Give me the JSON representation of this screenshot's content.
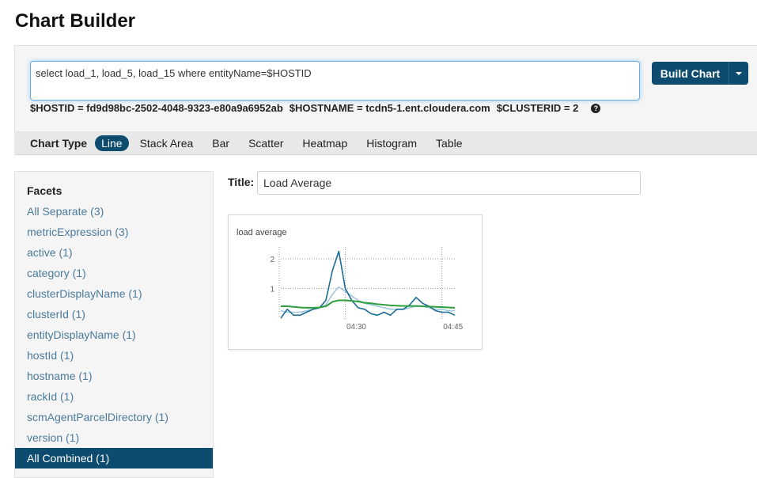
{
  "page": {
    "title": "Chart Builder"
  },
  "query": {
    "text": "select load_1, load_5, load_15 where entityName=$HOSTID",
    "build_label": "Build Chart"
  },
  "variables": {
    "hostid": "$HOSTID = fd9d98bc-2502-4048-9323-e80a9a6952ab",
    "hostname": "$HOSTNAME = tcdn5-1.ent.cloudera.com",
    "clusterid": "$CLUSTERID = 2",
    "help_icon": "question-circle-icon"
  },
  "chart_type": {
    "label": "Chart Type",
    "options": [
      "Line",
      "Stack Area",
      "Bar",
      "Scatter",
      "Heatmap",
      "Histogram",
      "Table"
    ],
    "selected": "Line"
  },
  "facets": {
    "title": "Facets",
    "items": [
      "All Separate (3)",
      "metricExpression (3)",
      "active (1)",
      "category (1)",
      "clusterDisplayName (1)",
      "clusterId (1)",
      "entityDisplayName (1)",
      "hostId (1)",
      "hostname (1)",
      "rackId (1)",
      "scmAgentParcelDirectory (1)",
      "version (1)",
      "All Combined (1)"
    ],
    "selected": "All Combined (1)"
  },
  "title_field": {
    "label": "Title:",
    "value": "Load Average"
  },
  "colors": {
    "accent": "#0d4c6e",
    "link": "#4a7a9c"
  },
  "chart_data": {
    "type": "line",
    "title": "load average",
    "x": [
      "04:20",
      "04:21",
      "04:22",
      "04:23",
      "04:24",
      "04:25",
      "04:26",
      "04:27",
      "04:28",
      "04:29",
      "04:30",
      "04:31",
      "04:32",
      "04:33",
      "04:34",
      "04:35",
      "04:36",
      "04:37",
      "04:38",
      "04:39",
      "04:40",
      "04:41",
      "04:42",
      "04:43",
      "04:44",
      "04:45",
      "04:46",
      "04:47"
    ],
    "x_ticks": [
      "04:30",
      "04:45"
    ],
    "y_ticks": [
      "1",
      "2"
    ],
    "ylim": [
      0,
      2.4
    ],
    "series": [
      {
        "color": "#1a6b96",
        "values": [
          0.0,
          0.3,
          0.1,
          0.1,
          0.2,
          0.3,
          0.35,
          0.6,
          1.6,
          2.25,
          1.0,
          0.6,
          0.35,
          0.3,
          0.15,
          0.1,
          0.2,
          0.1,
          0.3,
          0.3,
          0.45,
          0.7,
          0.5,
          0.4,
          0.25,
          0.2,
          0.2,
          0.1
        ]
      },
      {
        "color": "#9fc7da",
        "values": [
          0.25,
          0.2,
          0.2,
          0.2,
          0.25,
          0.3,
          0.35,
          0.45,
          0.8,
          1.05,
          0.9,
          0.75,
          0.6,
          0.5,
          0.45,
          0.4,
          0.35,
          0.3,
          0.3,
          0.3,
          0.35,
          0.4,
          0.4,
          0.35,
          0.3,
          0.3,
          0.25,
          0.25
        ]
      },
      {
        "color": "#2e9e3e",
        "values": [
          0.4,
          0.4,
          0.38,
          0.36,
          0.35,
          0.35,
          0.36,
          0.4,
          0.55,
          0.6,
          0.6,
          0.58,
          0.56,
          0.52,
          0.5,
          0.47,
          0.45,
          0.43,
          0.42,
          0.41,
          0.41,
          0.41,
          0.4,
          0.39,
          0.38,
          0.37,
          0.36,
          0.35
        ]
      }
    ],
    "grid": true
  }
}
